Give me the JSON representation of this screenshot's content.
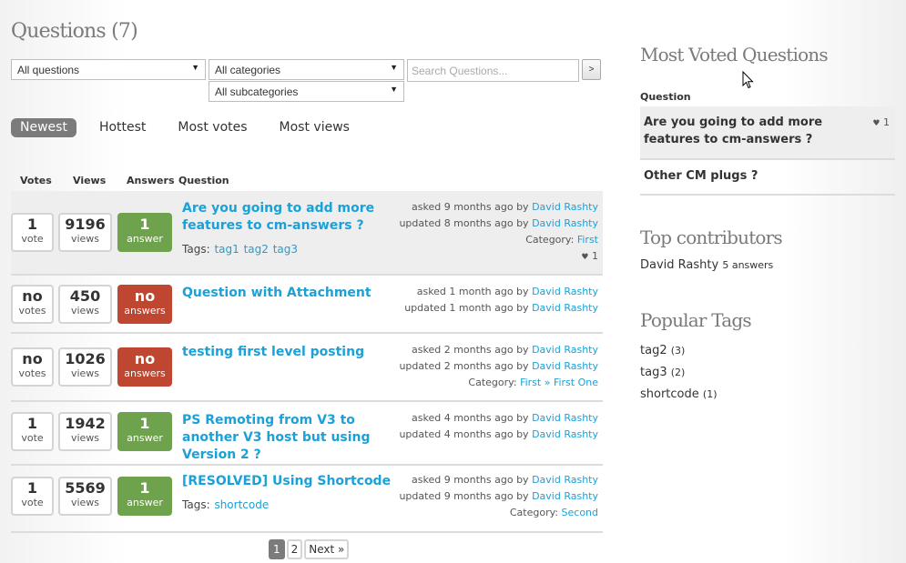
{
  "main": {
    "title": "Questions (7)",
    "filters": {
      "questions_select": "All questions",
      "categories_select": "All categories",
      "subcategories_select": "All subcategories",
      "search_placeholder": "Search Questions...",
      "search_button": ">"
    },
    "sort_tabs": [
      {
        "label": "Newest",
        "active": true
      },
      {
        "label": "Hottest",
        "active": false
      },
      {
        "label": "Most votes",
        "active": false
      },
      {
        "label": "Most views",
        "active": false
      }
    ],
    "columns": [
      "Votes",
      "Views",
      "Answers",
      "Question"
    ],
    "questions": [
      {
        "votes": "1",
        "votes_label": "vote",
        "views": "9196",
        "views_label": "views",
        "answers": "1",
        "answers_label": "answer",
        "answers_status": "green",
        "title": "Are you going to add more features to cm-answers ?",
        "tags_label": "Tags:",
        "tags": [
          "tag1",
          "tag2",
          "tag3"
        ],
        "asked": "asked 9 months ago by",
        "asked_by": "David Rashty",
        "updated": "updated 8 months ago by",
        "updated_by": "David Rashty",
        "category_label": "Category:",
        "category": [
          "First"
        ],
        "favorites": "1"
      },
      {
        "votes": "no",
        "votes_label": "votes",
        "views": "450",
        "views_label": "views",
        "answers": "no",
        "answers_label": "answers",
        "answers_status": "red",
        "title": "Question with Attachment",
        "asked": "asked 1 month ago by",
        "asked_by": "David Rashty",
        "updated": "updated 1 month ago by",
        "updated_by": "David Rashty"
      },
      {
        "votes": "no",
        "votes_label": "votes",
        "views": "1026",
        "views_label": "views",
        "answers": "no",
        "answers_label": "answers",
        "answers_status": "red",
        "title": "testing first level posting",
        "asked": "asked 2 months ago by",
        "asked_by": "David Rashty",
        "updated": "updated 2 months ago by",
        "updated_by": "David Rashty",
        "category_label": "Category:",
        "category": [
          "First",
          "First One"
        ],
        "category_separator": "»"
      },
      {
        "votes": "1",
        "votes_label": "vote",
        "views": "1942",
        "views_label": "views",
        "answers": "1",
        "answers_label": "answer",
        "answers_status": "green",
        "title": "PS Remoting from V3 to another V3 host but using Version 2 ?",
        "asked": "asked 4 months ago by",
        "asked_by": "David Rashty",
        "updated": "updated 4 months ago by",
        "updated_by": "David Rashty"
      },
      {
        "votes": "1",
        "votes_label": "vote",
        "views": "5569",
        "views_label": "views",
        "answers": "1",
        "answers_label": "answer",
        "answers_status": "green",
        "title": "[RESOLVED] Using Shortcode",
        "tags_label": "Tags:",
        "tags": [
          "shortcode"
        ],
        "asked": "asked 9 months ago by",
        "asked_by": "David Rashty",
        "updated": "updated 9 months ago by",
        "updated_by": "David Rashty",
        "category_label": "Category:",
        "category": [
          "Second"
        ]
      }
    ],
    "pagination": {
      "pages": [
        "1",
        "2"
      ],
      "current": "1",
      "next": "Next »"
    }
  },
  "sidebar": {
    "most_voted": {
      "title": "Most Voted Questions",
      "column": "Question",
      "items": [
        {
          "title": "Are you going to add more features to cm-answers ?",
          "votes": "1"
        },
        {
          "title": "Other CM plugs ?"
        }
      ]
    },
    "top_contributors": {
      "title": "Top contributors",
      "items": [
        {
          "name": "David Rashty",
          "count": "5 answers"
        }
      ]
    },
    "popular_tags": {
      "title": "Popular Tags",
      "items": [
        {
          "tag": "tag2",
          "count": "(3)"
        },
        {
          "tag": "tag3",
          "count": "(2)"
        },
        {
          "tag": "shortcode",
          "count": "(1)"
        }
      ]
    }
  },
  "colors": {
    "link": "#1ba1d7",
    "answered": "#6fa24c",
    "unanswered": "#bf4630",
    "active_tab": "#7b7b7b"
  }
}
